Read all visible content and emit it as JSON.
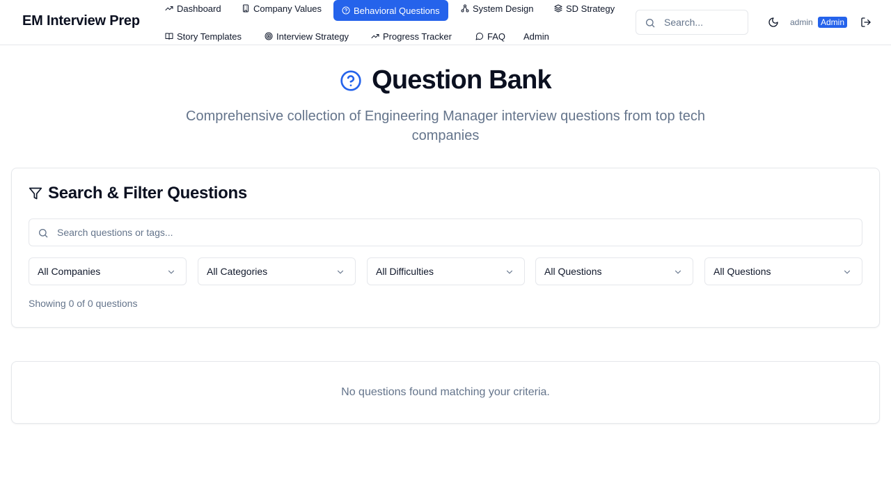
{
  "app": {
    "title": "EM Interview Prep"
  },
  "nav": {
    "items": [
      {
        "label": "Dashboard",
        "icon": "trending-up-icon"
      },
      {
        "label": "Company Values",
        "icon": "building-icon"
      },
      {
        "label": "Behavioral Questions",
        "icon": "help-circle-icon",
        "active": true
      },
      {
        "label": "System Design",
        "icon": "network-icon"
      },
      {
        "label": "SD Strategy",
        "icon": "layers-icon"
      },
      {
        "label": "Story Templates",
        "icon": "book-open-icon"
      },
      {
        "label": "Interview Strategy",
        "icon": "target-icon"
      },
      {
        "label": "Progress Tracker",
        "icon": "trending-up-icon"
      },
      {
        "label": "FAQ",
        "icon": "message-circle-icon"
      },
      {
        "label": "Admin",
        "icon": ""
      }
    ]
  },
  "header": {
    "search_placeholder": "Search...",
    "user_name": "admin",
    "user_role": "Admin",
    "accent_color": "#2563eb"
  },
  "hero": {
    "title": "Question Bank",
    "subtitle": "Comprehensive collection of Engineering Manager interview questions from top tech companies"
  },
  "filters": {
    "title": "Search & Filter Questions",
    "search_placeholder": "Search questions or tags...",
    "selects": [
      {
        "value": "All Companies"
      },
      {
        "value": "All Categories"
      },
      {
        "value": "All Difficulties"
      },
      {
        "value": "All Questions"
      },
      {
        "value": "All Questions"
      }
    ],
    "result_count": "Showing 0 of 0 questions"
  },
  "empty_state": {
    "message": "No questions found matching your criteria."
  }
}
